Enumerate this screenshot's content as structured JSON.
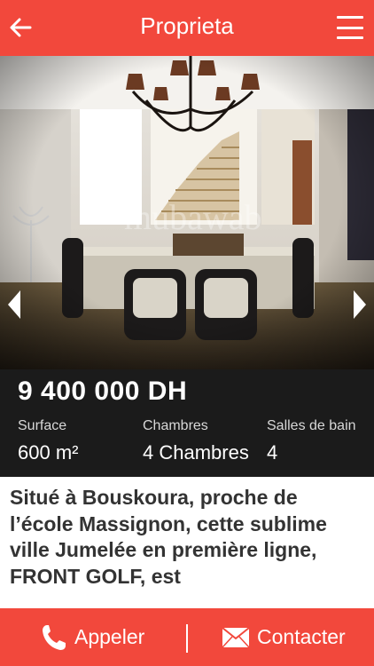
{
  "header": {
    "title": "Proprieta",
    "back_icon": "arrow-left-icon",
    "menu_icon": "hamburger-icon"
  },
  "gallery": {
    "prev_icon": "chevron-left-icon",
    "next_icon": "chevron-right-icon",
    "watermark": "mubawab"
  },
  "listing": {
    "price": "9 400 000 DH",
    "specs": [
      {
        "label": "Surface",
        "value": "600 m²"
      },
      {
        "label": "Chambres",
        "value": "4 Chambres"
      },
      {
        "label": "Salles de bain",
        "value": "4"
      }
    ],
    "description": "Situé à Bouskoura, proche de l’école Massignon, cette sublime ville Jumelée en première ligne, FRONT GOLF, est"
  },
  "actions": {
    "call_label": "Appeler",
    "contact_label": "Contacter",
    "call_icon": "phone-icon",
    "contact_icon": "envelope-icon"
  },
  "colors": {
    "brand": "#f2483c",
    "info_bg": "#1b1b1b"
  }
}
